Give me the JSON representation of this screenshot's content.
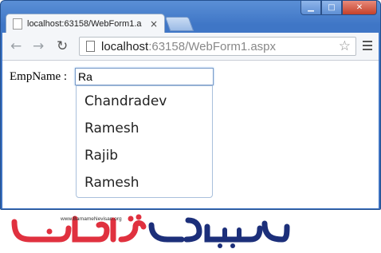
{
  "tab": {
    "title": "localhost:63158/WebForm1.a",
    "close": "×"
  },
  "window_controls": {
    "minimize": "▁",
    "maximize": "□",
    "close": "✕"
  },
  "toolbar": {
    "back": "←",
    "forward": "→",
    "reload": "↻",
    "url_host": "localhost",
    "url_rest": ":63158/WebForm1.aspx",
    "star": "☆"
  },
  "form": {
    "label": "EmpName :",
    "input_value": "Ra"
  },
  "suggestions": [
    "Chandradev",
    "Ramesh",
    "Rajib",
    "Ramesh"
  ],
  "logo": {
    "url_text": "www.BarnameNevisan.org",
    "brand_text": "برنامه نویسان"
  },
  "colors": {
    "frame": "#3f76c6",
    "logo_red": "#e0313f",
    "logo_blue": "#1c2f7a"
  }
}
